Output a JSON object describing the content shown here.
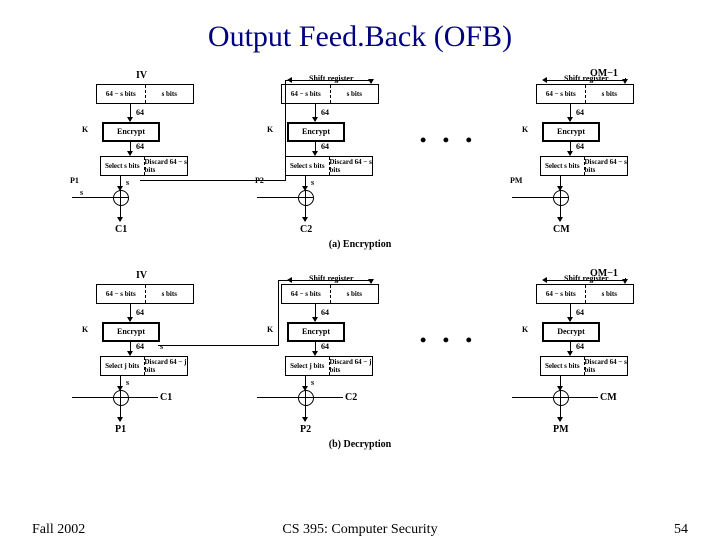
{
  "title": "Output Feed.Back (OFB)",
  "footer": {
    "left": "Fall 2002",
    "center": "CS 395: Computer Security",
    "right": "54"
  },
  "captions": {
    "encryption": "(a) Encryption",
    "decryption": "(b) Decryption"
  },
  "labels": {
    "IV": "IV",
    "shift_reg": "Shift register",
    "left_cell": "64 − s bits",
    "right_cell": "s bits",
    "K": "K",
    "encrypt": "Encrypt",
    "decrypt": "Decrypt",
    "n64": "64",
    "select_s": "Select\ns bits",
    "select_j": "Select\nj bits",
    "discard_s": "Discard\n64 − s bits",
    "discard_j": "Discard\n64 − j bits",
    "s": "s",
    "OM1": "OM−1",
    "ellipsis": "• • •"
  },
  "io": {
    "P": [
      "P1",
      "P2",
      "PM"
    ],
    "C": [
      "C1",
      "C2",
      "CM"
    ]
  }
}
